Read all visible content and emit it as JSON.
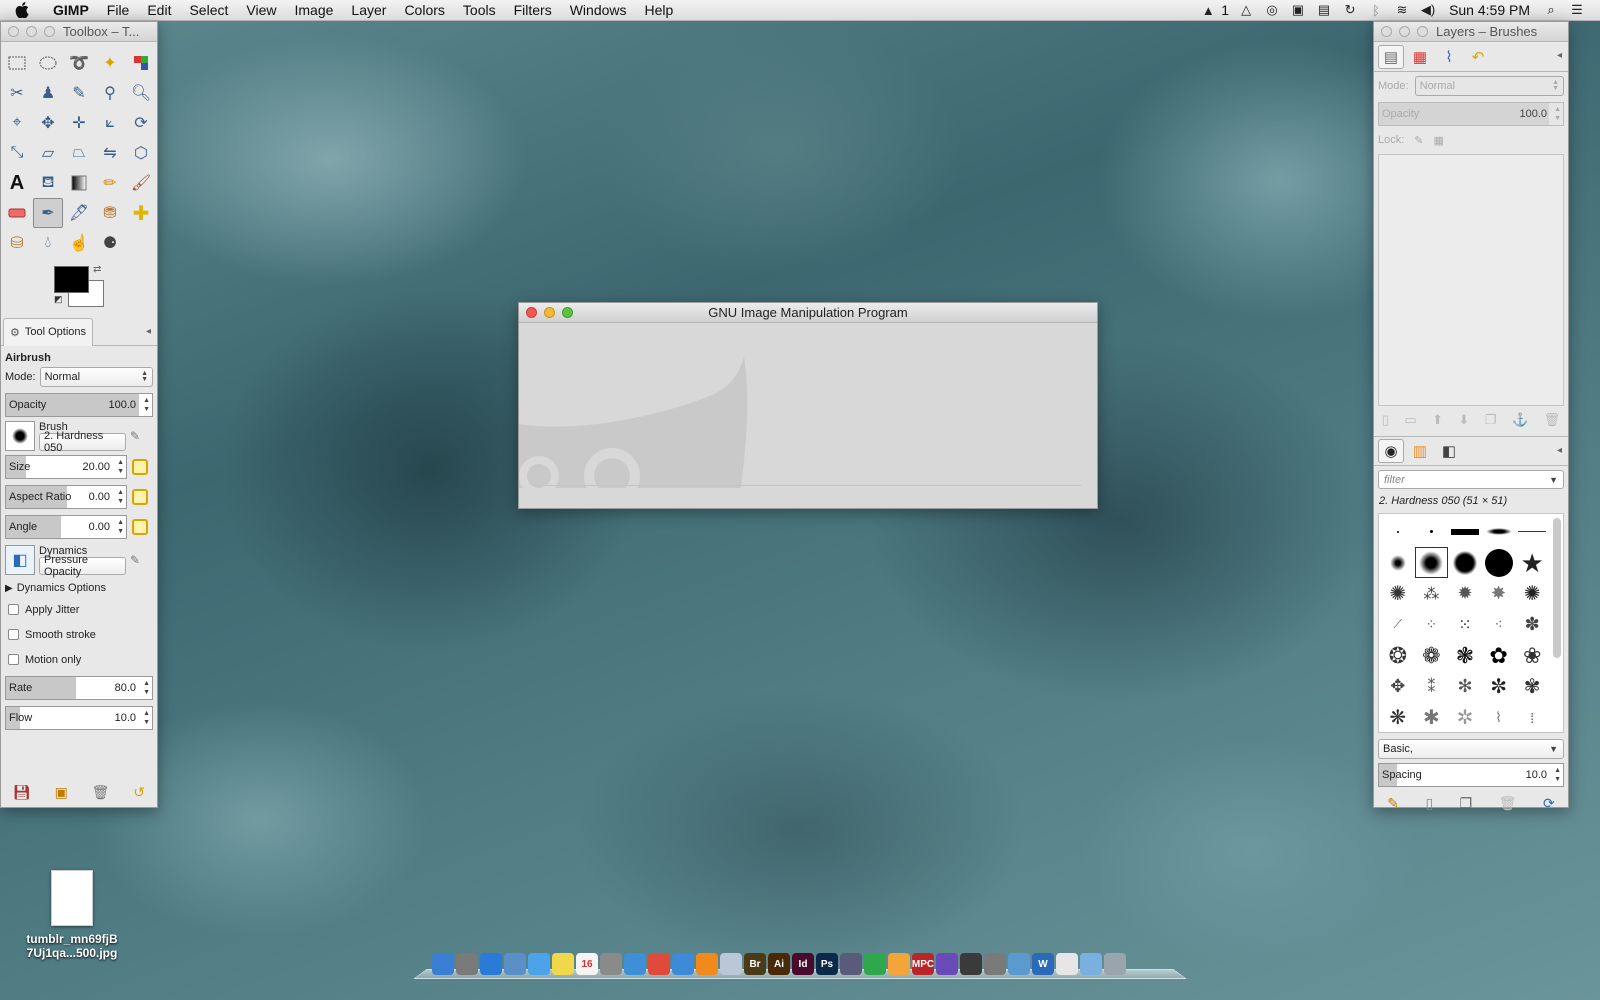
{
  "menubar": {
    "app": "GIMP",
    "items": [
      "File",
      "Edit",
      "Select",
      "View",
      "Image",
      "Layer",
      "Colors",
      "Tools",
      "Filters",
      "Windows",
      "Help"
    ],
    "status_count": "1",
    "clock": "Sun 4:59 PM"
  },
  "toolbox": {
    "title": "Toolbox – T...",
    "foreground_color": "#000000",
    "background_color": "#ffffff"
  },
  "tool_options": {
    "tab_label": "Tool Options",
    "tool_name": "Airbrush",
    "mode_label": "Mode:",
    "mode_value": "Normal",
    "opacity": {
      "label": "Opacity",
      "value": "100.0"
    },
    "brush_label": "Brush",
    "brush_value": "2. Hardness 050",
    "size": {
      "label": "Size",
      "value": "20.00"
    },
    "aspect": {
      "label": "Aspect Ratio",
      "value": "0.00"
    },
    "angle": {
      "label": "Angle",
      "value": "0.00"
    },
    "dynamics_label": "Dynamics",
    "dynamics_value": "Pressure Opacity",
    "dynamics_options": "Dynamics Options",
    "apply_jitter": "Apply Jitter",
    "smooth_stroke": "Smooth stroke",
    "motion_only": "Motion only",
    "rate": {
      "label": "Rate",
      "value": "80.0"
    },
    "flow": {
      "label": "Flow",
      "value": "10.0"
    }
  },
  "splash": {
    "title": "GNU Image Manipulation Program"
  },
  "layers": {
    "title": "Layers – Brushes",
    "mode_label": "Mode:",
    "mode_value": "Normal",
    "opacity_label": "Opacity",
    "opacity_value": "100.0",
    "lock_label": "Lock:"
  },
  "brushes": {
    "filter_placeholder": "filter",
    "selected_brush": "2. Hardness 050 (51 × 51)",
    "tag_value": "Basic,",
    "spacing_label": "Spacing",
    "spacing_value": "10.0"
  },
  "desktop": {
    "file_name_line1": "tumblr_mn69fjB",
    "file_name_line2": "7Uj1qa...500.jpg"
  },
  "dock": {
    "items": [
      {
        "name": "finder",
        "label": "",
        "color": "#3b7fd4"
      },
      {
        "name": "launchpad",
        "label": "",
        "color": "#7a7a7a"
      },
      {
        "name": "app-store",
        "label": "",
        "color": "#2a7ad8"
      },
      {
        "name": "preview",
        "label": "",
        "color": "#5a8fc8"
      },
      {
        "name": "messages",
        "label": "",
        "color": "#4da3e8"
      },
      {
        "name": "notes",
        "label": "",
        "color": "#f1d84a"
      },
      {
        "name": "calendar",
        "label": "16",
        "color": "#f4f4f4"
      },
      {
        "name": "rocket",
        "label": "",
        "color": "#8a8a8a"
      },
      {
        "name": "safari",
        "label": "",
        "color": "#3d8fd6"
      },
      {
        "name": "chrome",
        "label": "",
        "color": "#e04a3a"
      },
      {
        "name": "itunes",
        "label": "",
        "color": "#3c8ad8"
      },
      {
        "name": "vlc",
        "label": "",
        "color": "#f08a1c"
      },
      {
        "name": "mail",
        "label": "",
        "color": "#b9c7d6"
      },
      {
        "name": "bridge",
        "label": "Br",
        "color": "#4a3a16"
      },
      {
        "name": "illustrator",
        "label": "Ai",
        "color": "#4a2a06"
      },
      {
        "name": "indesign",
        "label": "Id",
        "color": "#4a0a2e"
      },
      {
        "name": "photoshop",
        "label": "Ps",
        "color": "#0b2a4a"
      },
      {
        "name": "finalcut",
        "label": "",
        "color": "#5a5a7a"
      },
      {
        "name": "spotify",
        "label": "",
        "color": "#2ea84a"
      },
      {
        "name": "pages",
        "label": "",
        "color": "#f3a43a"
      },
      {
        "name": "mpc",
        "label": "MPC",
        "color": "#b8262a"
      },
      {
        "name": "vpn",
        "label": "",
        "color": "#6a4ab8"
      },
      {
        "name": "gimp",
        "label": "",
        "color": "#3a3a3a"
      },
      {
        "name": "inkscape",
        "label": "",
        "color": "#7a7a7a"
      },
      {
        "name": "network",
        "label": "",
        "color": "#5a9ad0"
      },
      {
        "name": "word",
        "label": "W",
        "color": "#2a6ab8"
      },
      {
        "name": "documents",
        "label": "",
        "color": "#e6e6e6"
      },
      {
        "name": "folder",
        "label": "",
        "color": "#7ab0e0"
      },
      {
        "name": "trash",
        "label": "",
        "color": "#9aa4ac"
      }
    ]
  }
}
